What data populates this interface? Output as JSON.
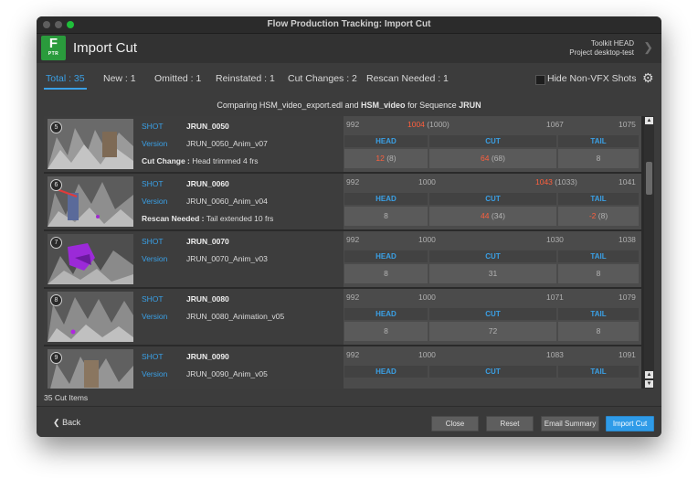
{
  "window": {
    "title": "Flow Production Tracking: Import Cut"
  },
  "header": {
    "logo_letter": "F",
    "logo_sub": "PTR",
    "app_title": "Import Cut",
    "toolkit_line1": "Toolkit HEAD",
    "toolkit_line2": "Project desktop-test"
  },
  "tabs": [
    {
      "label": "Total : 35",
      "active": true
    },
    {
      "label": "New : 1"
    },
    {
      "label": "Omitted : 1"
    },
    {
      "label": "Reinstated : 1"
    },
    {
      "label": "Cut Changes : 2"
    },
    {
      "label": "Rescan Needed : 1"
    }
  ],
  "filter": {
    "hide_label": "Hide Non-VFX Shots",
    "checked": false
  },
  "comparison": {
    "prefix": "Comparing",
    "edl": "HSM_video_export.edl",
    "and": "and",
    "video": "HSM_video",
    "for": "for Sequence",
    "sequence": "JRUN"
  },
  "labels": {
    "shot": "SHOT",
    "version": "Version",
    "head": "HEAD",
    "cut": "CUT",
    "tail": "TAIL"
  },
  "rows": [
    {
      "num": "5",
      "shot": "JRUN_0050",
      "version": "JRUN_0050_Anim_v07",
      "note_label": "Cut Change :",
      "note": "Head trimmed 4 frs",
      "tc1": "992",
      "tc2": "1004",
      "tc2_paren": "(1000)",
      "tc3": "1067",
      "tc4": "1075",
      "head": "12",
      "head_paren": "(8)",
      "cut": "64",
      "cut_paren": "(68)",
      "tail": "8",
      "tail_paren": ""
    },
    {
      "num": "6",
      "shot": "JRUN_0060",
      "version": "JRUN_0060_Anim_v04",
      "note_label": "Rescan Needed :",
      "note": "Tail extended 10 frs",
      "tc1": "992",
      "tc2": "1000",
      "tc2_paren": "",
      "tc3": "1043",
      "tc3_paren": "(1033)",
      "tc4": "1041",
      "head": "8",
      "head_paren": "",
      "cut": "44",
      "cut_paren": "(34)",
      "tail": "-2",
      "tail_paren": "(8)"
    },
    {
      "num": "7",
      "shot": "JRUN_0070",
      "version": "JRUN_0070_Anim_v03",
      "note_label": "",
      "note": "",
      "tc1": "992",
      "tc2": "1000",
      "tc3": "1030",
      "tc4": "1038",
      "head": "8",
      "cut": "31",
      "tail": "8"
    },
    {
      "num": "8",
      "shot": "JRUN_0080",
      "version": "JRUN_0080_Animation_v05",
      "note_label": "",
      "note": "",
      "tc1": "992",
      "tc2": "1000",
      "tc3": "1071",
      "tc4": "1079",
      "head": "8",
      "cut": "72",
      "tail": "8"
    },
    {
      "num": "9",
      "shot": "JRUN_0090",
      "version": "JRUN_0090_Anim_v05",
      "note_label": "",
      "note": "",
      "tc1": "992",
      "tc2": "1000",
      "tc3": "1083",
      "tc4": "1091",
      "head": "",
      "cut": "",
      "tail": ""
    }
  ],
  "status": {
    "count": "35 Cut Items"
  },
  "footer": {
    "back": "Back",
    "close": "Close",
    "reset": "Reset",
    "email_summary": "Email Summary",
    "import_cut": "Import Cut"
  },
  "colors": {
    "accent": "#3aa0e6",
    "changed": "#ff5f3d",
    "brand": "#2a9b3c"
  }
}
